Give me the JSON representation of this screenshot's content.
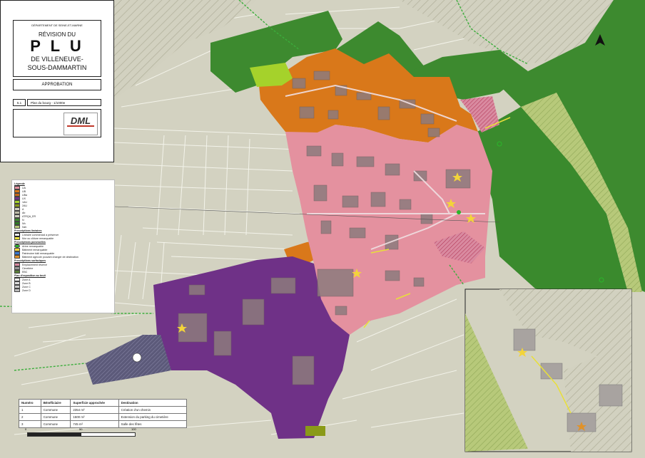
{
  "cartouche": {
    "department": "DÉPARTEMENT DE SEINE-ET-MARNE",
    "revision": "RÉVISION DU",
    "plu": "P L U",
    "commune_line1": "DE VILLENEUVE-",
    "commune_line2": "SOUS-DAMMARTIN",
    "stage": "APPROBATION",
    "piece_number": "5.1",
    "piece_title": "Plan du bourg - 1/1000e",
    "logo_text": "DML"
  },
  "legend": {
    "title": "Légende",
    "zoning_items": [
      "UA",
      "UB",
      "UBa",
      "UX",
      "1AU",
      "2AU",
      "A",
      "Ab",
      "ATRQA_ER",
      "N",
      "Nh",
      "Nzh"
    ],
    "prescriptions_head": "Prescriptions linéaires",
    "prescription_items": [
      "Linéaire commercial à préserver",
      "Mur ou clôture remarquable"
    ],
    "point_head": "Prescriptions ponctuelles",
    "point_items": [
      "Arbre remarquable",
      "Bâtiment remarquable",
      "Patrimoine bâti remarquable",
      "Bâtiment agricole pouvant changer de destination"
    ],
    "surface_head": "Prescriptions surfaciques",
    "surface_items": [
      "Emplacement réservé",
      "Cimetière",
      "EBC"
    ],
    "noise_head": "Plan d'exposition au bruit",
    "noise_items": [
      "Zone A",
      "Zone B",
      "Zone C",
      "Zone D"
    ]
  },
  "table": {
    "headers": [
      "Numéro",
      "Bénéficiaire",
      "Superficie approchée",
      "Destination"
    ],
    "rows": [
      [
        "1",
        "Commune",
        "2354 m²",
        "Création d'un chemin"
      ],
      [
        "2",
        "Commune",
        "1500 m²",
        "Extension du parking du cimetière"
      ],
      [
        "3",
        "Commune",
        "745 m²",
        "Salle des fêtes"
      ]
    ]
  },
  "scale": {
    "ticks": [
      "0",
      "50",
      "100"
    ]
  },
  "north_label": "N",
  "colors": {
    "UA": "#e4919f",
    "UB": "#d9781a",
    "UX": "#6f3187",
    "A_agri": "#d2d1c0",
    "N_forest": "#3d8a2f",
    "Nzh": "#b7c97a",
    "light_green": "#a5d22b"
  }
}
